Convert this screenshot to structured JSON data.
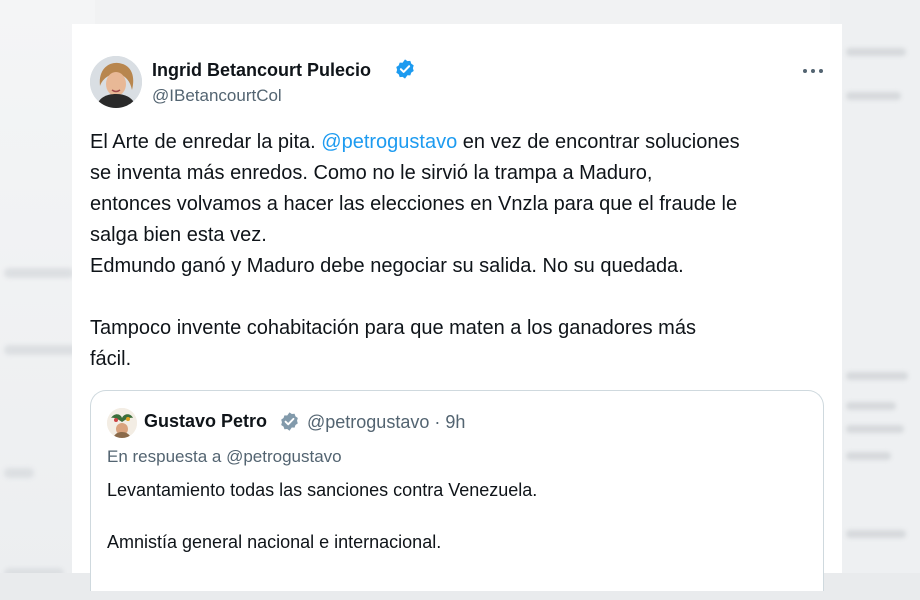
{
  "tweet": {
    "author": {
      "name": "Ingrid Betancourt Pulecio",
      "handle": "@IBetancourtCol",
      "verified_color": "#1d9bf0"
    },
    "more_icon": "ellipsis-icon",
    "body": {
      "line1_a": "El Arte de enredar la pita.",
      "line1_mention": "@petrogustavo",
      "line1_b": " en vez de encontrar soluciones",
      "line2": "se inventa más enredos.  Como no le sirvió la trampa a Maduro,",
      "line3": "entonces volvamos a hacer las elecciones en Vnzla para que el fraude le",
      "line4": "salga bien esta vez.",
      "line5": "Edmundo ganó y Maduro debe negociar su salida. No su quedada.",
      "line6": "Tampoco invente cohabitación para que maten a los ganadores más",
      "line7": "fácil."
    },
    "quoted": {
      "author_name": "Gustavo Petro",
      "meta": "@petrogustavo · 9h",
      "reply_to": "En respuesta a @petrogustavo",
      "line1": "Levantamiento todas las sanciones contra Venezuela.",
      "line2": "Amnistía general nacional e internacional."
    }
  },
  "colors": {
    "link": "#1d9bf0",
    "text": "#0f1419",
    "secondary": "#536471",
    "border": "#cfd9de"
  }
}
